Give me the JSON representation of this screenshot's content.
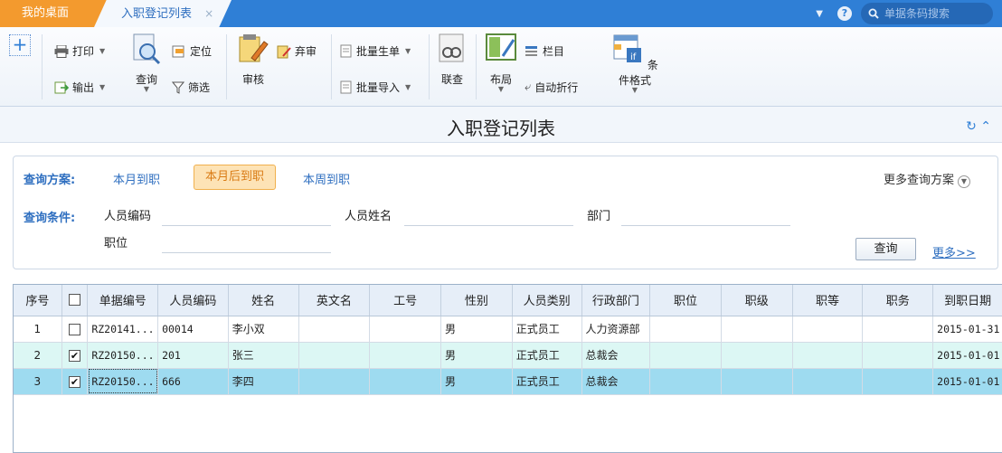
{
  "topbar": {
    "home_tab": "我的桌面",
    "active_tab": "入职登记列表",
    "close_glyph": "×",
    "search_placeholder": "单据条码搜索",
    "help_glyph": "?"
  },
  "toolbar": {
    "print": "打印",
    "export": "输出",
    "query": "查询",
    "locate": "定位",
    "filter": "筛选",
    "audit": "审核",
    "abandon_audit": "弃审",
    "batch_generate": "批量生单",
    "batch_import": "批量导入",
    "linked_query": "联查",
    "layout": "布局",
    "columns": "栏目",
    "auto_wrap": "自动折行",
    "conditional_format": "条件格式"
  },
  "page": {
    "title": "入职登记列表"
  },
  "query_panel": {
    "plan_label": "查询方案:",
    "plans": [
      "本月到职",
      "本月后到职",
      "本周到职"
    ],
    "active_plan": "本月后到职",
    "more_plans": "更多查询方案",
    "condition_label": "查询条件:",
    "fields": {
      "employee_code": "人员编码",
      "employee_name": "人员姓名",
      "department": "部门",
      "position": "职位"
    },
    "query_button": "查询",
    "more_link": "更多>>"
  },
  "table": {
    "columns": [
      "序号",
      "",
      "单据编号",
      "人员编码",
      "姓名",
      "英文名",
      "工号",
      "性别",
      "人员类别",
      "行政部门",
      "职位",
      "职级",
      "职等",
      "职务",
      "到职日期"
    ],
    "rows": [
      {
        "index": "1",
        "checked": false,
        "doc_no": "RZ20141...",
        "code": "00014",
        "name": "李小双",
        "english_name": "",
        "job_no": "",
        "gender": "男",
        "category": "正式员工",
        "department": "人力资源部",
        "position": "",
        "rank": "",
        "grade": "",
        "duty": "",
        "hire_date": "2015-01-31"
      },
      {
        "index": "2",
        "checked": true,
        "doc_no": "RZ20150...",
        "code": "201",
        "name": "张三",
        "english_name": "",
        "job_no": "",
        "gender": "男",
        "category": "正式员工",
        "department": "总裁会",
        "position": "",
        "rank": "",
        "grade": "",
        "duty": "",
        "hire_date": "2015-01-01"
      },
      {
        "index": "3",
        "checked": true,
        "doc_no": "RZ20150...",
        "code": "666",
        "name": "李四",
        "english_name": "",
        "job_no": "",
        "gender": "男",
        "category": "正式员工",
        "department": "总裁会",
        "position": "",
        "rank": "",
        "grade": "",
        "duty": "",
        "hire_date": "2015-01-01"
      }
    ],
    "check_glyph": "✔"
  },
  "colors": {
    "topbar_blue": "#2f7fd6",
    "home_tab_orange": "#f39a2e",
    "link_blue": "#2f6fc0",
    "active_plan_bg": "#fde3b6",
    "row_checked_bg": "#dcf7f4",
    "row_selected_bg": "#9edbf0"
  }
}
